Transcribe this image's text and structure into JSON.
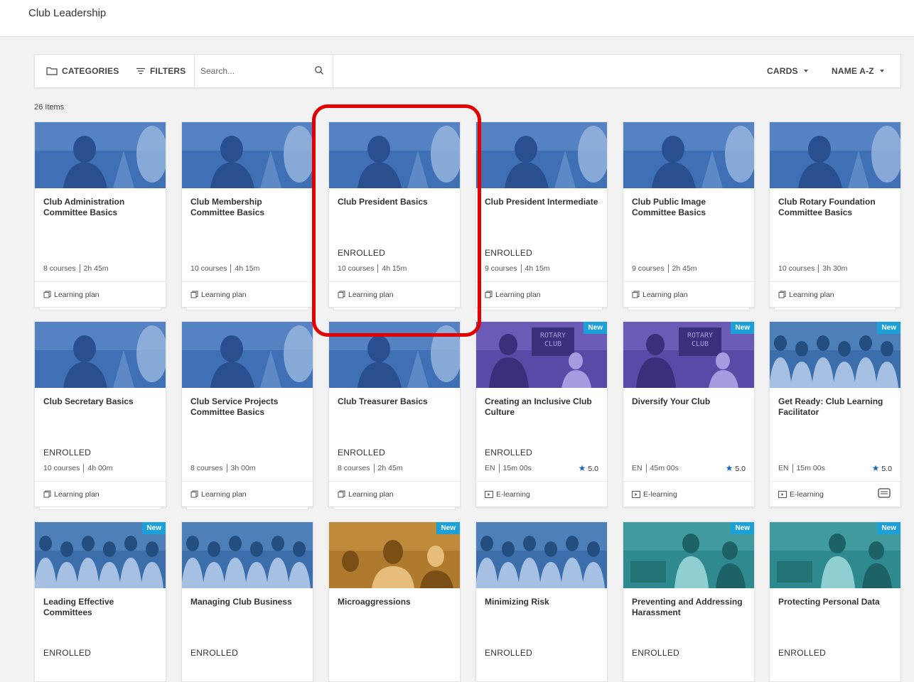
{
  "page": {
    "title": "Club Leadership"
  },
  "toolbar": {
    "categories_label": "CATEGORIES",
    "filters_label": "FILTERS",
    "search_placeholder": "Search...",
    "view_label": "CARDS",
    "sort_label": "NAME A-Z"
  },
  "item_count": "26 Items",
  "colors": {
    "accent_new": "#1ba0d7",
    "star": "#1565c0",
    "highlight": "#e30000"
  },
  "cards": [
    {
      "title": "Club Administration Committee Basics",
      "status": "",
      "meta_left": "8 courses",
      "meta_right": "2h 45m",
      "rating": "",
      "type": "Learning plan",
      "type_icon": "learning-plan-icon",
      "new": false,
      "image": "woman-glasses-blue",
      "stacked": true
    },
    {
      "title": "Club Membership Committee Basics",
      "status": "",
      "meta_left": "10 courses",
      "meta_right": "4h 15m",
      "rating": "",
      "type": "Learning plan",
      "type_icon": "learning-plan-icon",
      "new": false,
      "image": "woman-glasses-blue",
      "stacked": true
    },
    {
      "title": "Club President Basics",
      "status": "ENROLLED",
      "meta_left": "10 courses",
      "meta_right": "4h 15m",
      "rating": "",
      "type": "Learning plan",
      "type_icon": "learning-plan-icon",
      "new": false,
      "image": "woman-glasses-blue",
      "stacked": true
    },
    {
      "title": "Club President Intermediate",
      "status": "ENROLLED",
      "meta_left": "9 courses",
      "meta_right": "4h 15m",
      "rating": "",
      "type": "Learning plan",
      "type_icon": "learning-plan-icon",
      "new": false,
      "image": "woman-glasses-blue",
      "stacked": true
    },
    {
      "title": "Club Public Image Committee Basics",
      "status": "",
      "meta_left": "9 courses",
      "meta_right": "2h 45m",
      "rating": "",
      "type": "Learning plan",
      "type_icon": "learning-plan-icon",
      "new": false,
      "image": "woman-glasses-blue",
      "stacked": true
    },
    {
      "title": "Club Rotary Foundation Committee Basics",
      "status": "",
      "meta_left": "10 courses",
      "meta_right": "3h 30m",
      "rating": "",
      "type": "Learning plan",
      "type_icon": "learning-plan-icon",
      "new": false,
      "image": "woman-glasses-blue",
      "stacked": true
    },
    {
      "title": "Club Secretary Basics",
      "status": "ENROLLED",
      "meta_left": "10 courses",
      "meta_right": "4h 00m",
      "rating": "",
      "type": "Learning plan",
      "type_icon": "learning-plan-icon",
      "new": false,
      "image": "woman-glasses-blue",
      "stacked": true
    },
    {
      "title": "Club Service Projects Committee Basics",
      "status": "",
      "meta_left": "8 courses",
      "meta_right": "3h 00m",
      "rating": "",
      "type": "Learning plan",
      "type_icon": "learning-plan-icon",
      "new": false,
      "image": "woman-glasses-blue",
      "stacked": true
    },
    {
      "title": "Club Treasurer Basics",
      "status": "ENROLLED",
      "meta_left": "8 courses",
      "meta_right": "2h 45m",
      "rating": "",
      "type": "Learning plan",
      "type_icon": "learning-plan-icon",
      "new": false,
      "image": "woman-glasses-blue",
      "stacked": true
    },
    {
      "title": "Creating an Inclusive Club Culture",
      "status": "ENROLLED",
      "meta_left": "EN",
      "meta_right": "15m 00s",
      "rating": "5.0",
      "type": "E-learning",
      "type_icon": "e-learning-icon",
      "new": true,
      "image": "rotary-club-purple",
      "stacked": false
    },
    {
      "title": "Diversify Your Club",
      "status": "",
      "meta_left": "EN",
      "meta_right": "45m 00s",
      "rating": "5.0",
      "type": "E-learning",
      "type_icon": "e-learning-icon",
      "new": true,
      "image": "rotary-club-purple",
      "stacked": false
    },
    {
      "title": "Get Ready: Club Learning Facilitator",
      "status": "",
      "meta_left": "EN",
      "meta_right": "15m 00s",
      "rating": "5.0",
      "type": "E-learning",
      "type_icon": "e-learning-icon",
      "new": true,
      "image": "students-blue",
      "stacked": false,
      "chat": true
    },
    {
      "title": "Leading Effective Committees",
      "status": "ENROLLED",
      "meta_left": "",
      "meta_right": "",
      "rating": "",
      "type": "",
      "type_icon": "",
      "new": true,
      "image": "students-blue",
      "stacked": false
    },
    {
      "title": "Managing Club Business",
      "status": "ENROLLED",
      "meta_left": "",
      "meta_right": "",
      "rating": "",
      "type": "",
      "type_icon": "",
      "new": false,
      "image": "students-blue",
      "stacked": false
    },
    {
      "title": "Microaggressions",
      "status": "",
      "meta_left": "",
      "meta_right": "",
      "rating": "",
      "type": "",
      "type_icon": "",
      "new": true,
      "image": "group-orange",
      "stacked": false
    },
    {
      "title": "Minimizing Risk",
      "status": "ENROLLED",
      "meta_left": "",
      "meta_right": "",
      "rating": "",
      "type": "",
      "type_icon": "",
      "new": false,
      "image": "students-blue",
      "stacked": false
    },
    {
      "title": "Preventing and Addressing Harassment",
      "status": "ENROLLED",
      "meta_left": "",
      "meta_right": "",
      "rating": "",
      "type": "",
      "type_icon": "",
      "new": true,
      "image": "handshake-teal",
      "stacked": false
    },
    {
      "title": "Protecting Personal Data",
      "status": "ENROLLED",
      "meta_left": "",
      "meta_right": "",
      "rating": "",
      "type": "",
      "type_icon": "",
      "new": true,
      "image": "handshake-teal",
      "stacked": false
    }
  ],
  "badge_new_label": "New"
}
